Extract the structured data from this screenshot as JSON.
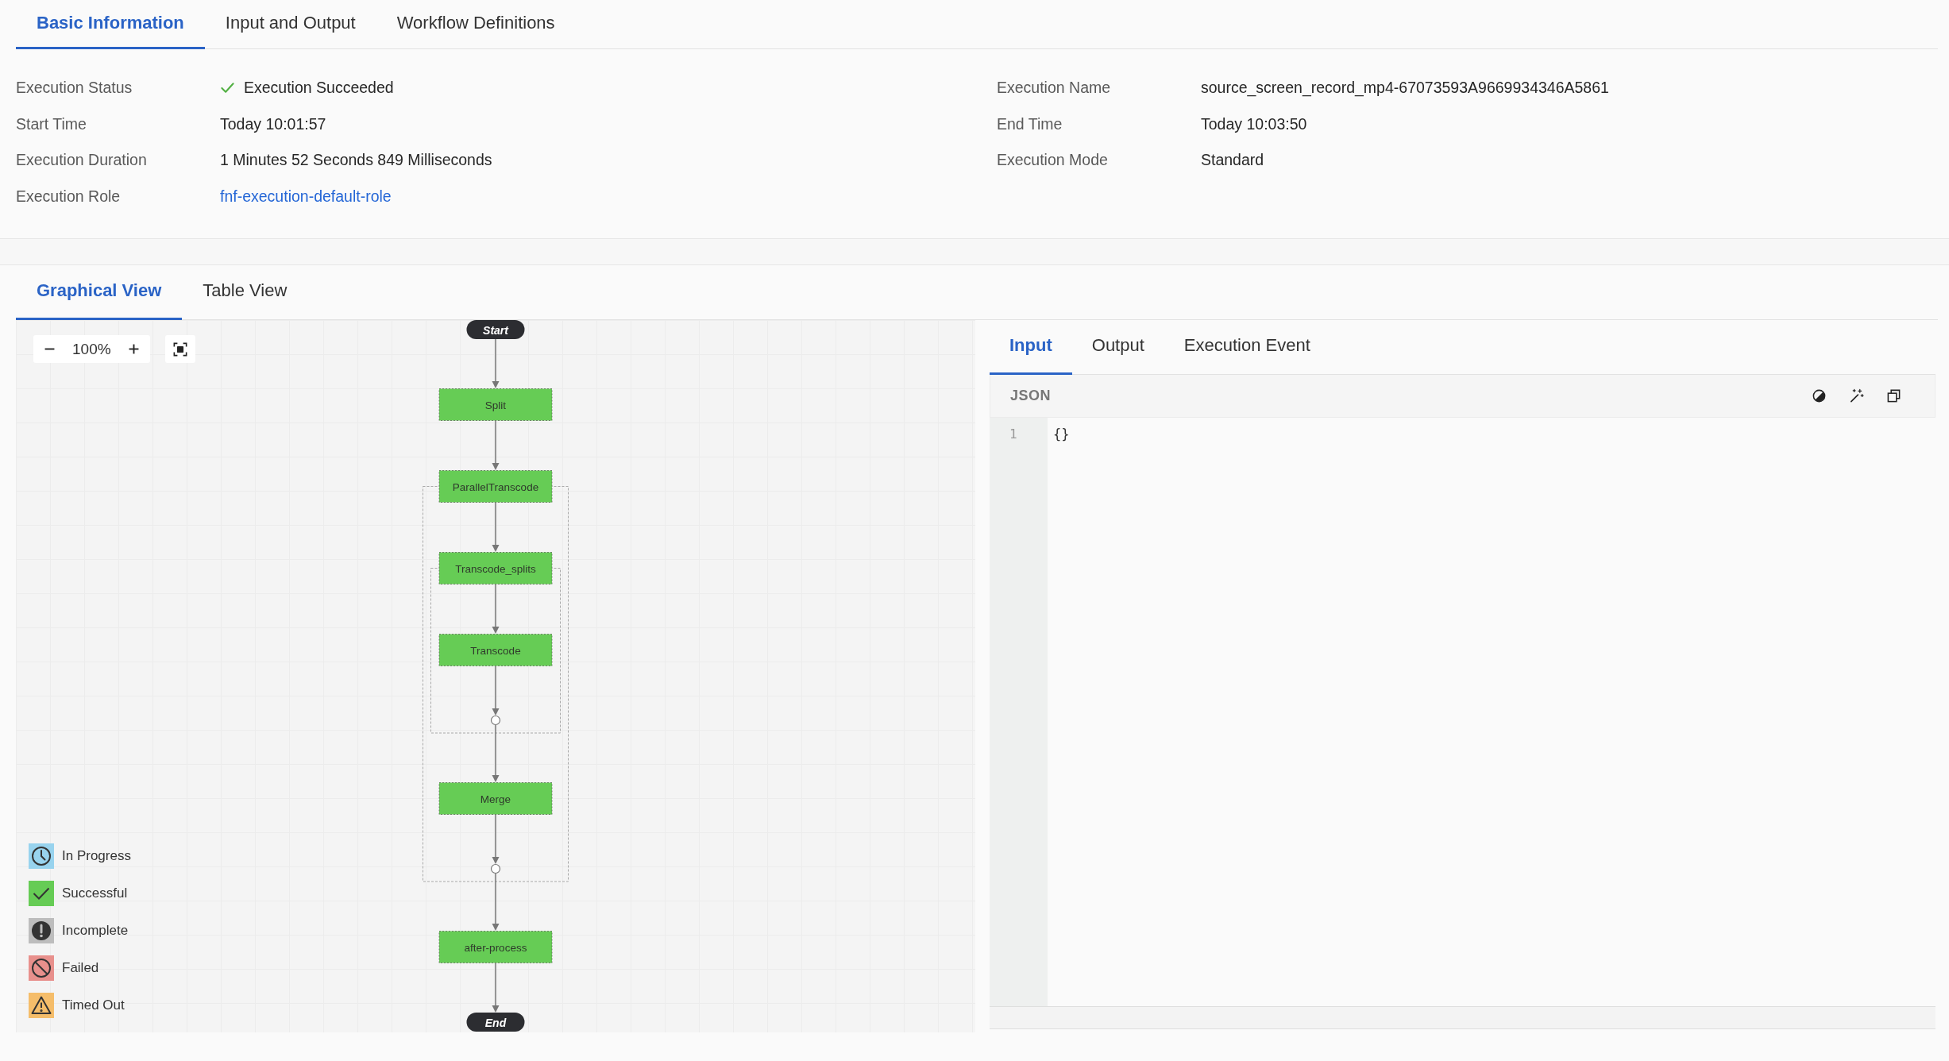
{
  "tabs": [
    {
      "label": "Basic Information",
      "selected": true
    },
    {
      "label": "Input and Output",
      "selected": false
    },
    {
      "label": "Workflow Definitions",
      "selected": false
    }
  ],
  "details": {
    "left": [
      {
        "label": "Execution Status",
        "value": "Execution Succeeded",
        "kind": "status"
      },
      {
        "label": "Start Time",
        "value": "Today 10:01:57",
        "kind": "text"
      },
      {
        "label": "Execution Duration",
        "value": "1 Minutes 52 Seconds 849 Milliseconds",
        "kind": "text"
      },
      {
        "label": "Execution Role",
        "value": "fnf-execution-default-role",
        "kind": "link"
      }
    ],
    "right": [
      {
        "label": "Execution Name",
        "value": "source_screen_record_mp4-67073593A9669934346A5861",
        "kind": "text"
      },
      {
        "label": "End Time",
        "value": "Today 10:03:50",
        "kind": "text"
      },
      {
        "label": "Execution Mode",
        "value": "Standard",
        "kind": "text"
      }
    ]
  },
  "view_tabs": [
    {
      "label": "Graphical View",
      "selected": true
    },
    {
      "label": "Table View",
      "selected": false
    }
  ],
  "graph": {
    "zoom": "100%",
    "nodes": [
      {
        "label": "Start",
        "kind": "terminal"
      },
      {
        "label": "Split",
        "kind": "task",
        "succeeded": true
      },
      {
        "label": "ParallelTranscode",
        "kind": "parallel",
        "succeeded": true,
        "children": [
          {
            "label": "Transcode_splits",
            "kind": "map",
            "succeeded": true,
            "children": [
              {
                "label": "Transcode",
                "kind": "task",
                "succeeded": true
              }
            ]
          },
          {
            "label": "Merge",
            "kind": "task",
            "succeeded": true
          }
        ]
      },
      {
        "label": "after-process",
        "kind": "task",
        "succeeded": true
      },
      {
        "label": "End",
        "kind": "terminal"
      }
    ],
    "legend": [
      {
        "label": "In Progress",
        "kind": "in_progress",
        "color": "#98d3ee"
      },
      {
        "label": "Successful",
        "kind": "successful",
        "color": "#66cc55"
      },
      {
        "label": "Incomplete",
        "kind": "incomplete",
        "color": "#bdbdbd"
      },
      {
        "label": "Failed",
        "kind": "failed",
        "color": "#e8908c"
      },
      {
        "label": "Timed Out",
        "kind": "timed_out",
        "color": "#f5bd6a"
      }
    ]
  },
  "io_panel": {
    "tabs": [
      {
        "label": "Input",
        "selected": true
      },
      {
        "label": "Output",
        "selected": false
      },
      {
        "label": "Execution Event",
        "selected": false
      }
    ],
    "format": "JSON",
    "lines": [
      {
        "number": "1",
        "code": "{}"
      }
    ]
  }
}
